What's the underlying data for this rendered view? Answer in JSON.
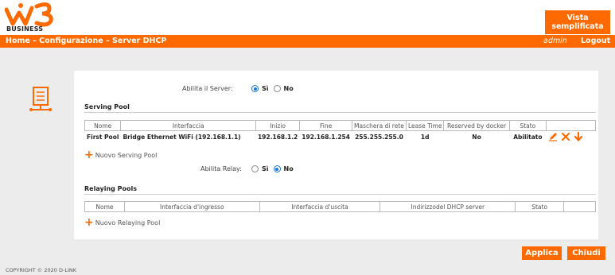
{
  "brand": {
    "logo_text": "BUSINESS",
    "accent_color": "#ff6a00"
  },
  "header": {
    "vista_button": "Vista semplificata"
  },
  "navbar": {
    "breadcrumb": "Home – Configurazione – Server DHCP",
    "user": "admin",
    "logout": "Logout"
  },
  "page_icon": "server-icon",
  "server": {
    "label": "Abilita il Server:",
    "options": [
      "Sì",
      "No"
    ],
    "selected": "Sì"
  },
  "serving_pool": {
    "title": "Serving Pool",
    "columns": [
      "Nome",
      "Interfaccia",
      "Inizio",
      "Fine",
      "Maschera di rete",
      "Lease Time",
      "Reserved by docker",
      "Stato",
      ""
    ],
    "rows": [
      {
        "nome": "First Pool",
        "interfaccia": "Bridge Ethernet WiFi (192.168.1.1)",
        "inizio": "192.168.1.2",
        "fine": "192.168.1.254",
        "maschera": "255.255.255.0",
        "lease": "1d",
        "reserved": "No",
        "stato": "Abilitato",
        "actions": [
          "edit-icon",
          "delete-icon",
          "move-down-icon"
        ]
      }
    ],
    "add_label": "Nuovo Serving Pool"
  },
  "relay": {
    "label": "Abilita Relay:",
    "options": [
      "Sì",
      "No"
    ],
    "selected": "No"
  },
  "relaying_pools": {
    "title": "Relaying Pools",
    "columns": [
      "Nome",
      "Interfaccia d'ingresso",
      "Interfaccia d'uscita",
      "Indirizzodel DHCP server",
      "Stato",
      ""
    ],
    "add_label": "Nuovo Relaying Pool"
  },
  "buttons": {
    "apply": "Applica",
    "close": "Chiudi"
  },
  "footer": {
    "copyright": "COPYRIGHT © 2020 D-LINK"
  }
}
